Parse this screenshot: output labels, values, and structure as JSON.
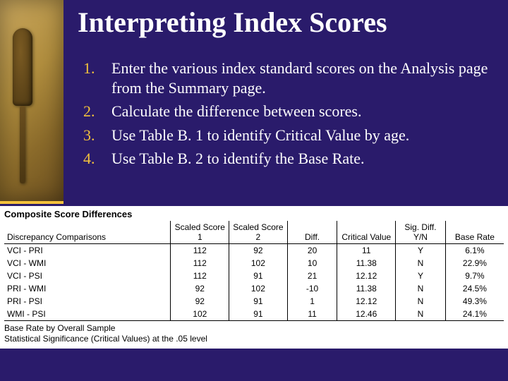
{
  "title": "Interpreting Index Scores",
  "list_items": [
    {
      "n": "1.",
      "text": "Enter the various index standard scores on the Analysis page from the Summary page."
    },
    {
      "n": "2.",
      "text": "Calculate the difference between scores."
    },
    {
      "n": "3.",
      "text": "Use Table B. 1 to identify Critical Value by age."
    },
    {
      "n": "4.",
      "text": "Use Table B. 2 to identify the Base Rate."
    }
  ],
  "table": {
    "title": "Composite Score Differences",
    "headers": {
      "comp": "Discrepancy Comparisons",
      "s1": "Scaled Score 1",
      "s2": "Scaled Score 2",
      "diff": "Diff.",
      "cv": "Critical Value",
      "yn": "Sig. Diff. Y/N",
      "br": "Base Rate"
    },
    "rows": [
      {
        "comp": "VCI - PRI",
        "s1": "112",
        "s2": "92",
        "diff": "20",
        "cv": "11",
        "yn": "Y",
        "br": "6.1%"
      },
      {
        "comp": "VCI - WMI",
        "s1": "112",
        "s2": "102",
        "diff": "10",
        "cv": "11.38",
        "yn": "N",
        "br": "22.9%"
      },
      {
        "comp": "VCI - PSI",
        "s1": "112",
        "s2": "91",
        "diff": "21",
        "cv": "12.12",
        "yn": "Y",
        "br": "9.7%"
      },
      {
        "comp": "PRI - WMI",
        "s1": "92",
        "s2": "102",
        "diff": "-10",
        "cv": "11.38",
        "yn": "N",
        "br": "24.5%"
      },
      {
        "comp": "PRI - PSI",
        "s1": "92",
        "s2": "91",
        "diff": "1",
        "cv": "12.12",
        "yn": "N",
        "br": "49.3%"
      },
      {
        "comp": "WMI - PSI",
        "s1": "102",
        "s2": "91",
        "diff": "11",
        "cv": "12.46",
        "yn": "N",
        "br": "24.1%"
      }
    ],
    "footnotes": [
      "Base Rate by Overall Sample",
      "Statistical Significance (Critical Values) at the .05 level"
    ]
  }
}
